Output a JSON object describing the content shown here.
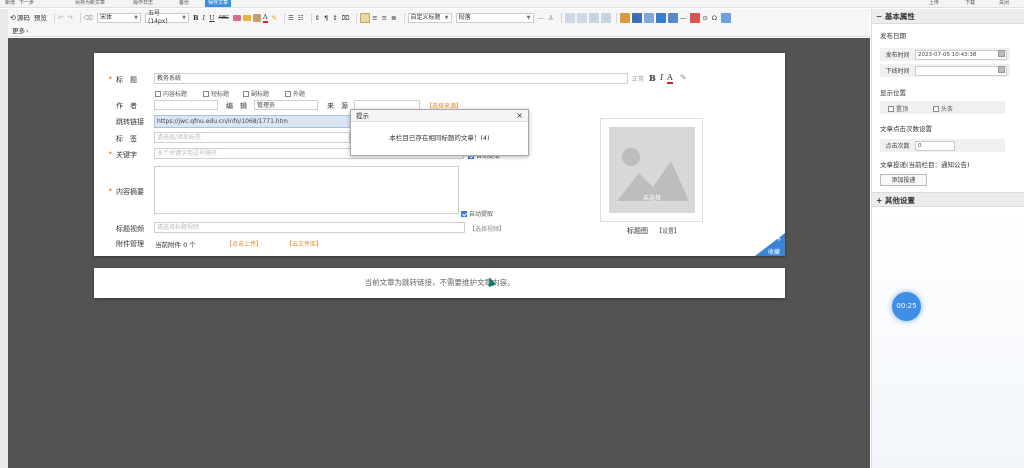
{
  "top_strip": {
    "items": [
      "新增",
      "下一步",
      "",
      "另存为新文章",
      "",
      "操作日志",
      "",
      "备份",
      "保存文章"
    ],
    "right_items": [
      "上传",
      "下载",
      "关闭"
    ]
  },
  "toolbar": {
    "source_label": "源码",
    "preview_label": "预览",
    "more_label": "更多",
    "font_family": "宋体",
    "font_size": "五号(14px)",
    "heading_style": "自定义标题",
    "paragraph": "段落"
  },
  "form": {
    "title_label": "标　题",
    "title_value": "教务系统",
    "title_options": [
      "内容标题",
      "短标题",
      "副标题",
      "外题"
    ],
    "author_label": "作　者",
    "editor_label": "编　辑",
    "editor_value": "管理员",
    "source_label": "来　源",
    "source_link": "【选择来源】",
    "jump_label": "跳转链接",
    "jump_value": "https://jwc.qfnu.edu.cn/info/1068/1771.htm",
    "tag_label": "标　签",
    "tag_placeholder": "请选择/添加标签",
    "keyword_label": "关键字",
    "keyword_placeholder": "多个关键字用逗号隔开",
    "auto_extract_label": "自动提取",
    "summary_label": "内容摘要",
    "auto_summary_label": "自动提取",
    "title_video_label": "标题视频",
    "title_video_placeholder": "请选择标题视频",
    "choose_video_link": "【选择视频】",
    "attachment_label": "附件管理",
    "attachment_count": "当前附件 0 个",
    "upload_link": "【点击上传】",
    "cloud_link": "【云文件库】",
    "thumb_placeholder": "未选择",
    "thumb_label": "标题图",
    "thumb_set": "【设置】",
    "collect_label": "收藏",
    "text_size_hint": "正常"
  },
  "notice": {
    "text": "当前文章为跳转链接，不需要维护文章内容。"
  },
  "dialog": {
    "title": "提示",
    "message": "本栏目已存在相同标题的文章！(4)",
    "close": "×"
  },
  "right_panel": {
    "basic_header": "基本属性",
    "publish_date_label": "发布日期",
    "publish_time_label": "发布时间",
    "publish_time_value": "2023-07-05 10:43:38",
    "offline_time_label": "下线时间",
    "offline_time_value": "",
    "display_label": "显示位置",
    "top_option": "置顶",
    "headline_option": "头条",
    "click_label": "文章点击次数设置",
    "click_count_label": "点击次数",
    "click_count_value": "0",
    "push_label": "文章投递(当前栏目：通知公告)",
    "add_push_button": "添加投递",
    "other_header": "其他设置",
    "timer": "00:25"
  }
}
